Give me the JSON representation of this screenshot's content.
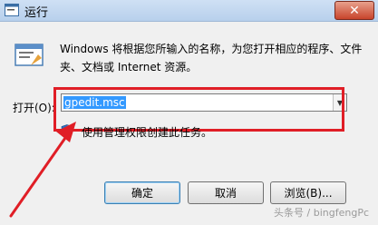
{
  "window": {
    "title": "运行",
    "close_glyph": "✕"
  },
  "description": "Windows 将根据您所输入的名称，为您打开相应的程序、文件夹、文档或 Internet 资源。",
  "open_field": {
    "label": "打开(O):",
    "value": "gpedit.msc"
  },
  "admin_note": "使用管理权限创建此任务。",
  "buttons": {
    "ok": "确定",
    "cancel": "取消",
    "browse": "浏览(B)..."
  },
  "watermark": "头条号 / bingfengPc",
  "colors": {
    "highlight": "#e01e26",
    "selection": "#3399ff"
  },
  "icons": [
    "run-window-icon",
    "run-program-icon",
    "uac-shield-icon",
    "dropdown-arrow-icon",
    "close-icon"
  ]
}
